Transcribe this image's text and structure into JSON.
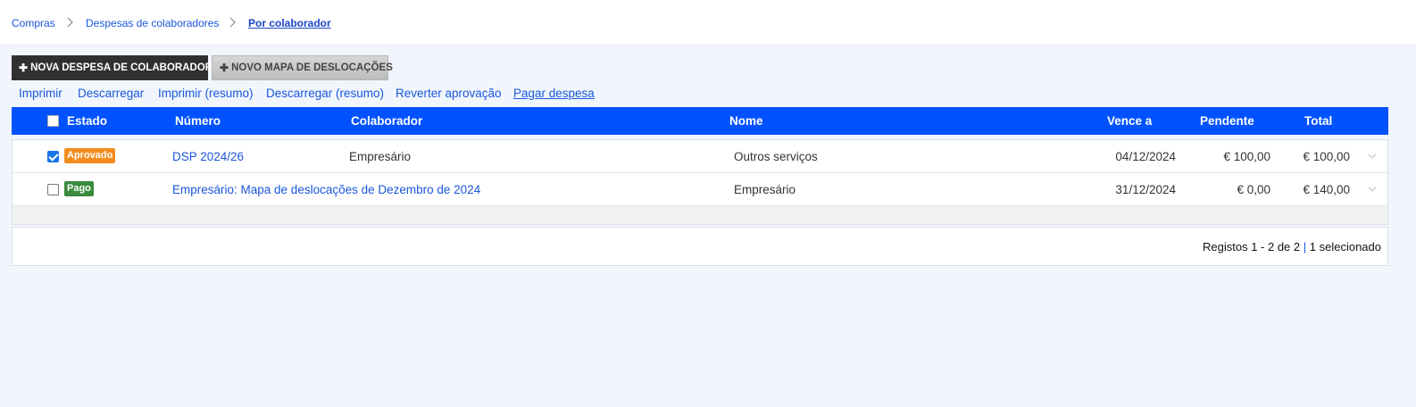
{
  "breadcrumb": {
    "items": [
      "Compras",
      "Despesas de colaboradores"
    ],
    "current": "Por colaborador"
  },
  "toolbar": {
    "new_expense_label": "NOVA DESPESA DE COLABORADOR",
    "new_map_label": "NOVO MAPA DE DESLOCAÇÕES",
    "plus_glyph": "✚"
  },
  "actions": [
    "Imprimir",
    "Descarregar",
    "Imprimir (resumo)",
    "Descarregar (resumo)",
    "Reverter aprovação",
    "Pagar despesa"
  ],
  "table": {
    "headers": {
      "estado": "Estado",
      "numero": "Número",
      "colaborador": "Colaborador",
      "nome": "Nome",
      "vence": "Vence a",
      "pendente": "Pendente",
      "total": "Total"
    },
    "rows": [
      {
        "checked": true,
        "status": "Aprovado",
        "status_color": "#f28c1e",
        "numero": "DSP 2024/26",
        "colaborador": "Empresário",
        "nome": "Outros serviços",
        "vence": "04/12/2024",
        "pendente": "€ 100,00",
        "total": "€ 100,00"
      },
      {
        "checked": false,
        "status": "Pago",
        "status_color": "#3a8a3e",
        "numero": "Empresário: Mapa de deslocações de Dezembro de 2024",
        "colaborador": "",
        "nome": "Empresário",
        "vence": "31/12/2024",
        "pendente": "€ 0,00",
        "total": "€ 140,00"
      }
    ]
  },
  "footer": {
    "records": "Registos 1 - 2 de 2",
    "separator": "|",
    "selected": "1 selecionado"
  },
  "colors": {
    "header_bg": "#0052ff",
    "link": "#1a56db",
    "primary_button": "#303030"
  }
}
